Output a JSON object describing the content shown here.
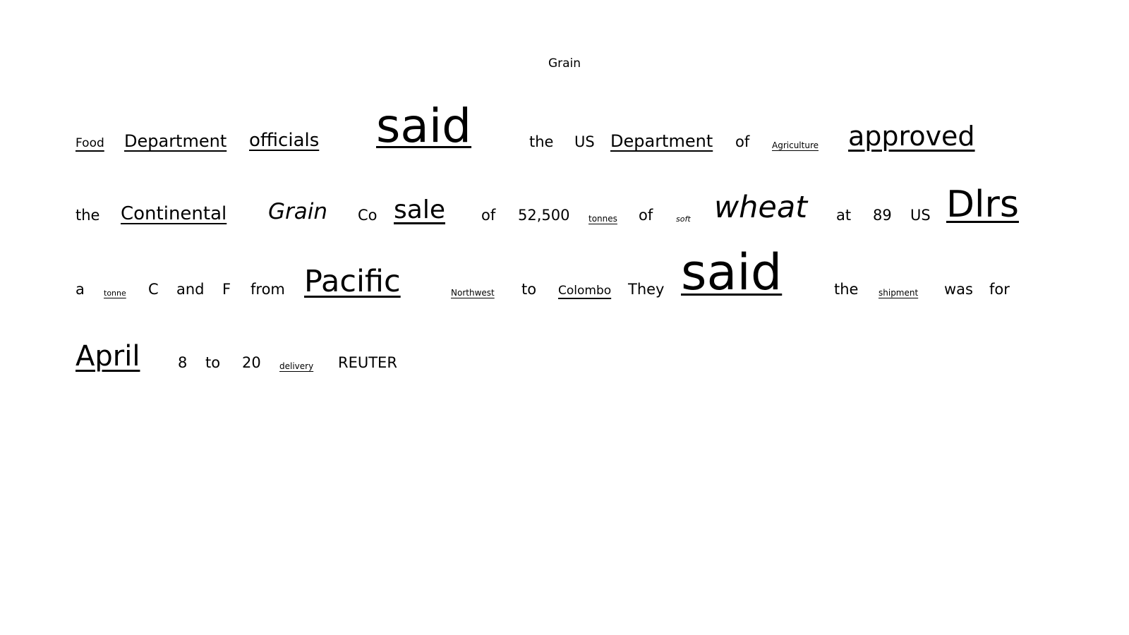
{
  "title": "Grain",
  "words": [
    {
      "text": "Food",
      "size": 17,
      "underline": true
    },
    {
      "text": "Department",
      "size": 24,
      "underline": true
    },
    {
      "text": "officials",
      "size": 26,
      "underline": true
    },
    {
      "text": "said",
      "size": 66,
      "underline": true
    },
    {
      "text": "the",
      "size": 21
    },
    {
      "text": "US",
      "size": 21
    },
    {
      "text": "Department",
      "size": 24,
      "underline": true
    },
    {
      "text": "of",
      "size": 21
    },
    {
      "text": "Agriculture",
      "size": 12,
      "underline": true
    },
    {
      "text": "approved",
      "size": 38,
      "underline": true
    },
    {
      "text": "the",
      "size": 21
    },
    {
      "text": "Continental",
      "size": 26,
      "underline": true
    },
    {
      "text": "Grain",
      "size": 31,
      "italic": true
    },
    {
      "text": "Co",
      "size": 21
    },
    {
      "text": "sale",
      "size": 36,
      "underline": true
    },
    {
      "text": "of",
      "size": 21
    },
    {
      "text": "52,500",
      "size": 21
    },
    {
      "text": "tonnes",
      "size": 12,
      "underline": true
    },
    {
      "text": "of",
      "size": 21
    },
    {
      "text": "soft",
      "size": 11,
      "italic": true
    },
    {
      "text": "wheat",
      "size": 43,
      "italic": true
    },
    {
      "text": "at",
      "size": 21
    },
    {
      "text": "89",
      "size": 21
    },
    {
      "text": "US",
      "size": 21
    },
    {
      "text": "Dlrs",
      "size": 52,
      "underline": true
    },
    {
      "text": "a",
      "size": 21
    },
    {
      "text": "tonne",
      "size": 11,
      "underline": true
    },
    {
      "text": "C",
      "size": 21
    },
    {
      "text": "and",
      "size": 21
    },
    {
      "text": "F",
      "size": 21
    },
    {
      "text": "from",
      "size": 21
    },
    {
      "text": "Pacific",
      "size": 43,
      "underline": true
    },
    {
      "text": "Northwest",
      "size": 12,
      "underline": true
    },
    {
      "text": "to",
      "size": 21
    },
    {
      "text": "Colombo",
      "size": 17,
      "underline": true
    },
    {
      "text": "They",
      "size": 21
    },
    {
      "text": "said",
      "size": 70,
      "underline": true
    },
    {
      "text": "the",
      "size": 21
    },
    {
      "text": "shipment",
      "size": 12,
      "underline": true
    },
    {
      "text": "was",
      "size": 21
    },
    {
      "text": "for",
      "size": 21
    },
    {
      "text": "April",
      "size": 40,
      "underline": true
    },
    {
      "text": "8",
      "size": 21
    },
    {
      "text": "to",
      "size": 21
    },
    {
      "text": "20",
      "size": 21
    },
    {
      "text": "delivery",
      "size": 12,
      "underline": true
    },
    {
      "text": "REUTER",
      "size": 21
    }
  ]
}
